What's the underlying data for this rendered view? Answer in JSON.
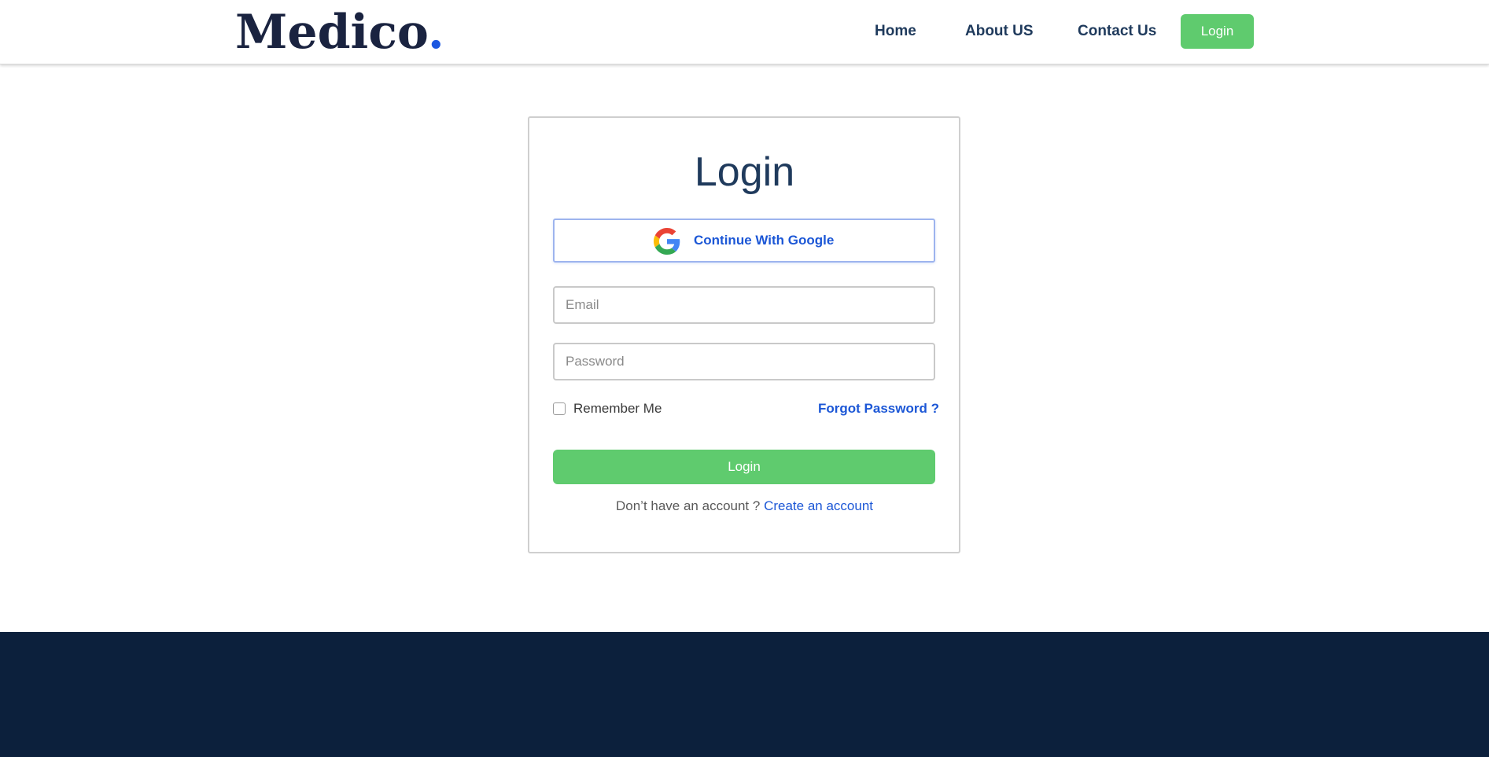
{
  "header": {
    "logo_text": "Medico",
    "logo_dot": ".",
    "nav": {
      "home": "Home",
      "about": "About US",
      "contact": "Contact Us",
      "login": "Login"
    }
  },
  "login_card": {
    "title": "Login",
    "google_button_label": "Continue With Google",
    "google_icon": "google-logo-icon",
    "email_placeholder": "Email",
    "email_value": "",
    "password_placeholder": "Password",
    "password_value": "",
    "remember_label": "Remember Me",
    "remember_checked": false,
    "forgot_link": "Forgot Password ?",
    "submit_label": "Login",
    "signup_prompt": "Don’t have an account ?",
    "signup_link": "Create an account"
  },
  "colors": {
    "brand_navy": "#1f3a5c",
    "accent_blue": "#1c57d6",
    "button_green": "#5fcb6e",
    "footer_bg": "#0c203c"
  }
}
